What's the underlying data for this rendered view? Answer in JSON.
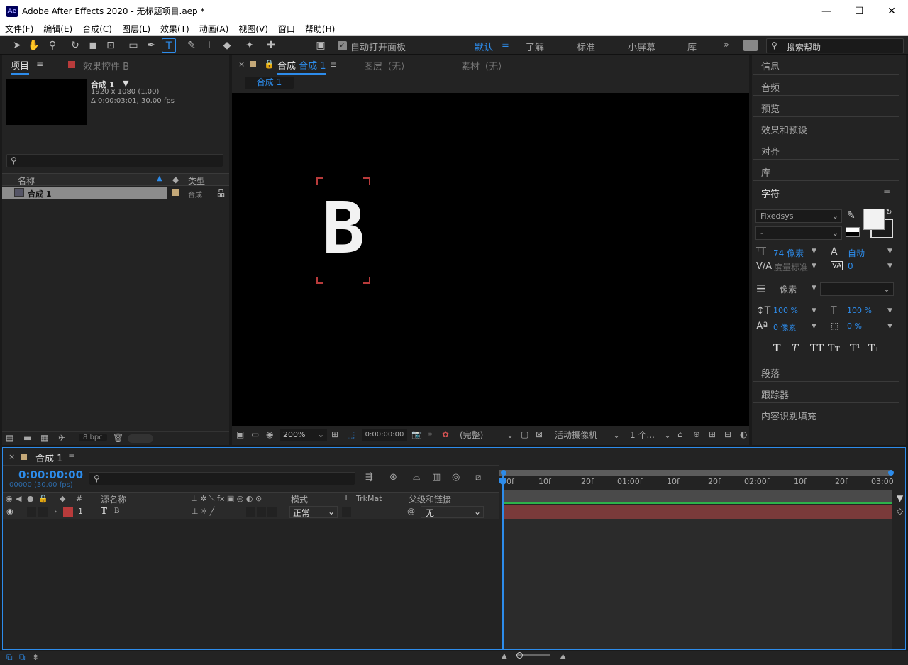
{
  "window": {
    "title": "Adobe After Effects 2020 - 无标题项目.aep *",
    "logo": "Ae"
  },
  "menu": [
    "文件(F)",
    "编辑(E)",
    "合成(C)",
    "图层(L)",
    "效果(T)",
    "动画(A)",
    "视图(V)",
    "窗口",
    "帮助(H)"
  ],
  "toolbar": {
    "auto_open": "自动打开面板",
    "workspaces": [
      "默认",
      "了解",
      "标准",
      "小屏幕",
      "库"
    ],
    "search_placeholder": "搜索帮助"
  },
  "project": {
    "tab": "项目",
    "effects_tab": "效果控件 B",
    "comp_name": "合成 1",
    "comp_res": "1920 x 1080 (1.00)",
    "comp_dur": "Δ 0:00:03:01, 30.00 fps",
    "col_name": "名称",
    "col_type": "类型",
    "item_name": "合成 1",
    "item_type": "合成",
    "bpc": "8 bpc"
  },
  "viewer": {
    "tab_prefix": "合成",
    "tab_name": "合成 1",
    "layer_tab": "图层（无）",
    "footage_tab": "素材（无）",
    "breadcrumb": "合成 1",
    "letter": "B",
    "zoom": "200%",
    "timecode": "0:00:00:00",
    "quality": "(完整)",
    "camera": "活动摄像机",
    "views": "1 个..."
  },
  "right": {
    "items": [
      "信息",
      "音频",
      "预览",
      "效果和预设",
      "对齐",
      "库",
      "字符"
    ],
    "font": "Fixedsys",
    "font_style": "-",
    "size": "74 像素",
    "leading": "自动",
    "kerning": "度量标准",
    "tracking": "0",
    "stroke": "- 像素",
    "vscale": "100 %",
    "hscale": "100 %",
    "baseline": "0 像素",
    "tsume": "0 %",
    "styles": [
      "T",
      "T",
      "TT",
      "Tт",
      "T¹",
      "T₁"
    ],
    "items2": [
      "段落",
      "跟踪器",
      "内容识别填充"
    ]
  },
  "timeline": {
    "tab": "合成 1",
    "timecode": "0:00:00:00",
    "fps": "00000 (30.00 fps)",
    "col_source": "源名称",
    "col_mode": "模式",
    "col_t": "T",
    "col_trkmat": "TrkMat",
    "col_parent": "父级和链接",
    "layer_num": "1",
    "layer_name": "B",
    "layer_mode": "正常",
    "layer_parent": "无",
    "ruler": [
      "0f",
      "10f",
      "20f",
      "01:00f",
      "10f",
      "20f",
      "02:00f",
      "10f",
      "20f",
      "03:00"
    ]
  },
  "colors": {
    "accent": "#2d8ceb",
    "layer_label": "#b83b3b",
    "layer_bar": "#7a3a3a"
  }
}
